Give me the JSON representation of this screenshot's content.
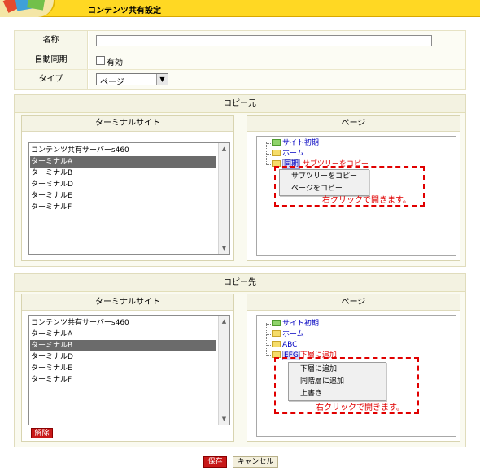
{
  "header": {
    "title": "コンテンツ共有設定",
    "accent": "#ffd823"
  },
  "form": {
    "name_label": "名称",
    "name_value": "",
    "sync_label": "自動同期",
    "sync_checkbox_label": "有効",
    "sync_checked": false,
    "type_label": "タイプ",
    "type_value": "ページ"
  },
  "source": {
    "title": "コピー元",
    "terminal_header": "ターミナルサイト",
    "page_header": "ページ",
    "terminals": [
      "コンテンツ共有サーバーs460",
      "ターミナルA",
      "ターミナルB",
      "ターミナルD",
      "ターミナルE",
      "ターミナルF"
    ],
    "selected_terminal": "ターミナルA",
    "tree": {
      "site_init": "サイト初期",
      "home": "ホーム",
      "sync_node": "同期",
      "sync_hint": "サブツリーをコピー"
    },
    "context_menu": [
      "サブツリーをコピー",
      "ページをコピー"
    ],
    "note": "右クリックで開きます。"
  },
  "dest": {
    "title": "コピー先",
    "terminal_header": "ターミナルサイト",
    "page_header": "ページ",
    "terminals": [
      "コンテンツ共有サーバーs460",
      "ターミナルA",
      "ターミナルB",
      "ターミナルD",
      "ターミナルE",
      "ターミナルF"
    ],
    "selected_terminal": "ターミナルB",
    "tree": {
      "site_init": "サイト初期",
      "home": "ホーム",
      "abc": "ABC",
      "efg_node": "EFG",
      "efg_hint": "下層に追加"
    },
    "context_menu": [
      "下層に追加",
      "同階層に追加",
      "上書き"
    ],
    "note": "右クリックで開きます。",
    "remove_button": "解除"
  },
  "actions": {
    "save": "保存",
    "cancel": "キャンセル"
  }
}
